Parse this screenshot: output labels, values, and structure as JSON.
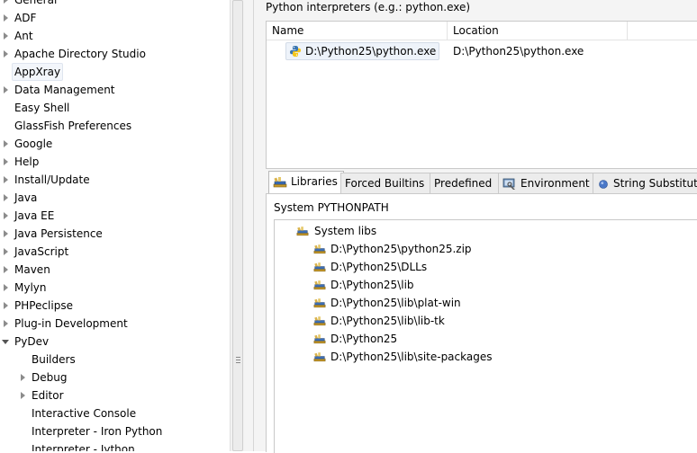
{
  "tree": {
    "items": [
      {
        "label": "General",
        "toggle": "collapsed",
        "level": 0
      },
      {
        "label": "ADF",
        "toggle": "collapsed",
        "level": 0
      },
      {
        "label": "Ant",
        "toggle": "collapsed",
        "level": 0
      },
      {
        "label": "Apache Directory Studio",
        "toggle": "collapsed",
        "level": 0
      },
      {
        "label": "AppXray",
        "toggle": "none",
        "level": 0,
        "selected": true
      },
      {
        "label": "Data Management",
        "toggle": "collapsed",
        "level": 0
      },
      {
        "label": "Easy Shell",
        "toggle": "none",
        "level": 0
      },
      {
        "label": "GlassFish Preferences",
        "toggle": "none",
        "level": 0
      },
      {
        "label": "Google",
        "toggle": "collapsed",
        "level": 0
      },
      {
        "label": "Help",
        "toggle": "collapsed",
        "level": 0
      },
      {
        "label": "Install/Update",
        "toggle": "collapsed",
        "level": 0
      },
      {
        "label": "Java",
        "toggle": "collapsed",
        "level": 0
      },
      {
        "label": "Java EE",
        "toggle": "collapsed",
        "level": 0
      },
      {
        "label": "Java Persistence",
        "toggle": "collapsed",
        "level": 0
      },
      {
        "label": "JavaScript",
        "toggle": "collapsed",
        "level": 0
      },
      {
        "label": "Maven",
        "toggle": "collapsed",
        "level": 0
      },
      {
        "label": "Mylyn",
        "toggle": "collapsed",
        "level": 0
      },
      {
        "label": "PHPeclipse",
        "toggle": "collapsed",
        "level": 0
      },
      {
        "label": "Plug-in Development",
        "toggle": "collapsed",
        "level": 0
      },
      {
        "label": "PyDev",
        "toggle": "expanded",
        "level": 0
      },
      {
        "label": "Builders",
        "toggle": "none",
        "level": 1
      },
      {
        "label": "Debug",
        "toggle": "collapsed",
        "level": 1
      },
      {
        "label": "Editor",
        "toggle": "collapsed",
        "level": 1
      },
      {
        "label": "Interactive Console",
        "toggle": "none",
        "level": 1
      },
      {
        "label": "Interpreter - Iron Python",
        "toggle": "none",
        "level": 1
      },
      {
        "label": "Interpreter - Jython",
        "toggle": "none",
        "level": 1
      }
    ]
  },
  "interpreters": {
    "caption": "Python interpreters (e.g.: python.exe)",
    "columns": [
      "Name",
      "Location"
    ],
    "rows": [
      {
        "name": "D:\\Python25\\python.exe",
        "location": "D:\\Python25\\python.exe"
      }
    ]
  },
  "tabs": {
    "items": [
      {
        "label": "Libraries",
        "icon": "libraries-icon",
        "active": true
      },
      {
        "label": "Forced Builtins",
        "icon": "",
        "active": false
      },
      {
        "label": "Predefined",
        "icon": "",
        "active": false
      },
      {
        "label": "Environment",
        "icon": "environment-icon",
        "active": false
      },
      {
        "label": "String Substitut",
        "icon": "string-substitution-icon",
        "active": false
      }
    ]
  },
  "libraries": {
    "section_label": "System PYTHONPATH",
    "root_label": "System libs",
    "paths": [
      "D:\\Python25\\python25.zip",
      "D:\\Python25\\DLLs",
      "D:\\Python25\\lib",
      "D:\\Python25\\lib\\plat-win",
      "D:\\Python25\\lib\\lib-tk",
      "D:\\Python25",
      "D:\\Python25\\lib\\site-packages"
    ]
  },
  "colors": {
    "selection_bg": "#eef3fa",
    "panel_bg": "#f4f4f4",
    "tab_inactive_bg": "#ececec"
  }
}
